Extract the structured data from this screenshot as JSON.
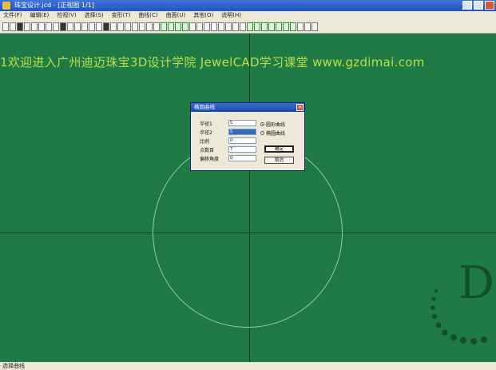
{
  "window": {
    "title": "珠宝设计.jcd - [正视图 1/1]"
  },
  "menu": [
    "文件(F)",
    "编辑(E)",
    "检视(V)",
    "选择(S)",
    "变形(T)",
    "曲线(C)",
    "曲面(U)",
    "其他(O)",
    "说明(H)"
  ],
  "canvas": {
    "watermark": "1欢迎进入广州迪迈珠宝3D设计学院 JewelCAD学习课堂 www.gzdimai.com",
    "logo_letter": "D"
  },
  "dialog": {
    "title": "椭圆曲线",
    "fields": [
      {
        "label": "半径1",
        "value": "5"
      },
      {
        "label": "半径2",
        "value": "5"
      },
      {
        "label": "比例",
        "value": "0"
      },
      {
        "label": "点数目",
        "value": "7"
      },
      {
        "label": "偏移角度",
        "value": "0"
      }
    ],
    "radios": [
      {
        "label": "圆形曲线",
        "checked": true
      },
      {
        "label": "椭圆曲线",
        "checked": false
      }
    ],
    "ok_label": "确定",
    "cancel_label": "取消"
  },
  "status": {
    "text": "选择曲线"
  }
}
